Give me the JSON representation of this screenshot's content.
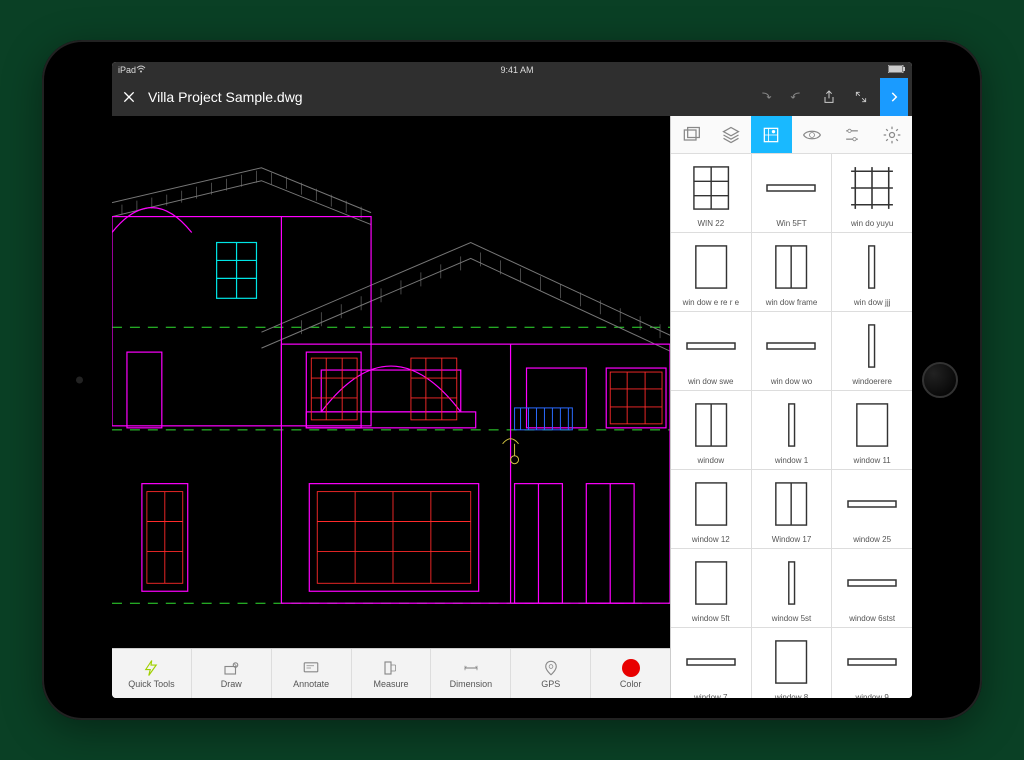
{
  "status": {
    "carrier": "iPad",
    "time": "9:41 AM"
  },
  "titlebar": {
    "filename": "Villa Project Sample.dwg"
  },
  "tools": [
    {
      "id": "quick-tools",
      "label": "Quick Tools"
    },
    {
      "id": "draw",
      "label": "Draw"
    },
    {
      "id": "annotate",
      "label": "Annotate"
    },
    {
      "id": "measure",
      "label": "Measure"
    },
    {
      "id": "dimension",
      "label": "Dimension"
    },
    {
      "id": "gps",
      "label": "GPS"
    },
    {
      "id": "color",
      "label": "Color"
    }
  ],
  "blocks": [
    {
      "label": "WIN 22",
      "kind": "win6"
    },
    {
      "label": "Win 5FT",
      "kind": "hbar"
    },
    {
      "label": "win do yuyu",
      "kind": "grid"
    },
    {
      "label": "win dow e re r e",
      "kind": "rect"
    },
    {
      "label": "win dow frame",
      "kind": "split"
    },
    {
      "label": "win dow jjj",
      "kind": "vbar"
    },
    {
      "label": "win dow swe",
      "kind": "hbar"
    },
    {
      "label": "win dow wo",
      "kind": "hbar"
    },
    {
      "label": "windoerere",
      "kind": "vbar"
    },
    {
      "label": "window",
      "kind": "split"
    },
    {
      "label": "window 1",
      "kind": "vbar"
    },
    {
      "label": "window 11",
      "kind": "rect"
    },
    {
      "label": "window 12",
      "kind": "rect"
    },
    {
      "label": "Window 17",
      "kind": "split"
    },
    {
      "label": "window 25",
      "kind": "hbar"
    },
    {
      "label": "window 5ft",
      "kind": "rect"
    },
    {
      "label": "window 5st",
      "kind": "vbar"
    },
    {
      "label": "window 6stst",
      "kind": "hbar"
    },
    {
      "label": "window 7",
      "kind": "hbar"
    },
    {
      "label": "window 8",
      "kind": "rect"
    },
    {
      "label": "window 9",
      "kind": "hbar"
    }
  ],
  "colors": {
    "magenta": "#ff00ff",
    "cyan": "#00e5e5",
    "green": "#30e030",
    "red": "#ff2a2a",
    "blue": "#2a6aff",
    "yellow": "#d0c040",
    "grey": "#777"
  }
}
